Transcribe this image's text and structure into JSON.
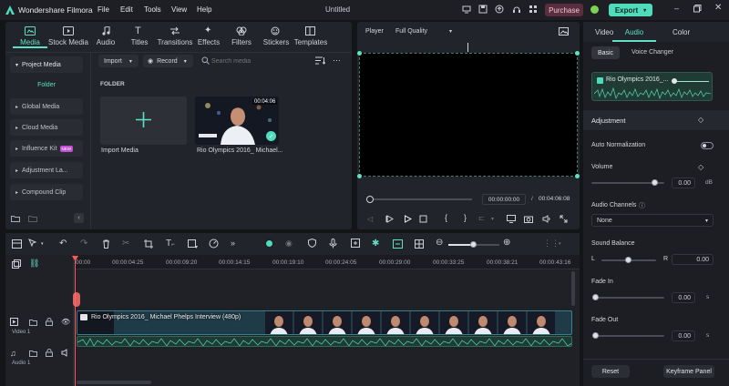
{
  "app": {
    "name": "Wondershare Filmora",
    "project_title": "Untitled"
  },
  "menu": [
    "File",
    "Edit",
    "Tools",
    "View",
    "Help"
  ],
  "titlebar_buttons": {
    "purchase": "Purchase",
    "export": "Export"
  },
  "toolbar_tabs": [
    "Media",
    "Stock Media",
    "Audio",
    "Titles",
    "Transitions",
    "Effects",
    "Filters",
    "Stickers",
    "Templates"
  ],
  "sidebar": {
    "items": [
      "Project Media",
      "Folder",
      "Global Media",
      "Cloud Media",
      "Influence Kit",
      "Adjustment La...",
      "Compound Clip"
    ],
    "badge": "NEW"
  },
  "media_bar": {
    "import": "Import",
    "record": "Record",
    "search_placeholder": "Search media"
  },
  "media": {
    "folder_label": "FOLDER",
    "import_label": "Import Media",
    "clip_name": "Rio Olympics 2016_ Michael...",
    "clip_duration": "00:04:06"
  },
  "player": {
    "label": "Player",
    "quality": "Full Quality",
    "current_time": "00:00:00:00",
    "total_time": "00:04:06:08"
  },
  "timeline": {
    "ruler": [
      "00:00",
      "00:00:04:25",
      "00:00:09:20",
      "00:00:14:15",
      "00:00:19:10",
      "00:00:24:05",
      "00:00:29:00",
      "00:00:33:25",
      "00:00:38:21",
      "00:00:43:16"
    ],
    "video_track": "Video 1",
    "audio_track": "Audio 1",
    "clip_title": "Rio Olympics 2016_ Michael Phelps Interview (480p)"
  },
  "inspector": {
    "tabs": [
      "Video",
      "Audio",
      "Color"
    ],
    "active_tab": "Audio",
    "subtabs": [
      "Basic",
      "Voice Changer"
    ],
    "clip_name": "Rio Olympics 2016_...",
    "adjustment": "Adjustment",
    "auto_normalization": "Auto Normalization",
    "volume": {
      "label": "Volume",
      "value": "0.00",
      "unit": "dB"
    },
    "channels": {
      "label": "Audio Channels",
      "value": "None"
    },
    "balance": {
      "label": "Sound Balance",
      "left": "L",
      "right": "R",
      "value": "0.00"
    },
    "fade_in": {
      "label": "Fade In",
      "value": "0.00",
      "unit": "s"
    },
    "fade_out": {
      "label": "Fade Out",
      "value": "0.00",
      "unit": "s"
    },
    "reset": "Reset",
    "keyframe": "Keyframe Panel"
  },
  "colors": {
    "accent": "#5fe0c2",
    "purchase_bg": "#5a2d3f",
    "export_bg": "#4fdcbc",
    "playhead": "#ff5a5a",
    "clip_bg": "#1f3b47"
  }
}
